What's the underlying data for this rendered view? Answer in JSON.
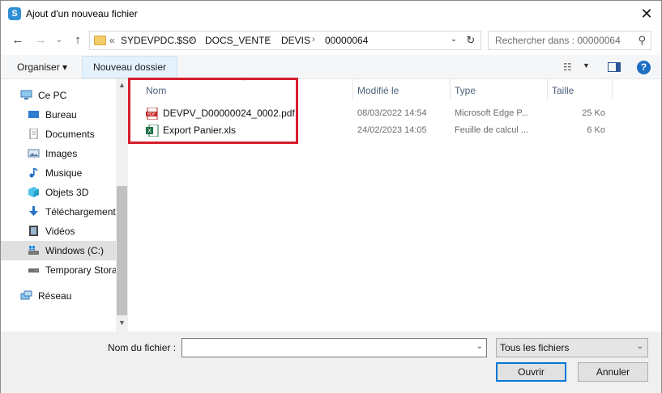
{
  "window": {
    "title": "Ajout d'un nouveau fichier"
  },
  "address": {
    "prefix": "«",
    "crumbs": [
      "SYDEVPDC.$SO",
      "DOCS_VENTE",
      "DEVIS",
      "00000064"
    ],
    "separator": "›"
  },
  "search": {
    "placeholder": "Rechercher dans : 00000064"
  },
  "toolbar": {
    "organise_label": "Organiser ▾",
    "new_folder_label": "Nouveau dossier"
  },
  "sidebar": {
    "items": [
      {
        "label": "Ce PC",
        "icon": "pc-icon"
      },
      {
        "label": "Bureau",
        "icon": "desktop-icon"
      },
      {
        "label": "Documents",
        "icon": "documents-icon"
      },
      {
        "label": "Images",
        "icon": "pictures-icon"
      },
      {
        "label": "Musique",
        "icon": "music-icon"
      },
      {
        "label": "Objets 3D",
        "icon": "objects3d-icon"
      },
      {
        "label": "Téléchargements",
        "icon": "downloads-icon"
      },
      {
        "label": "Vidéos",
        "icon": "videos-icon"
      },
      {
        "label": "Windows (C:)",
        "icon": "drive-c-icon"
      },
      {
        "label": "Temporary Storage",
        "icon": "drive-icon"
      },
      {
        "label": "Réseau",
        "icon": "network-icon"
      }
    ]
  },
  "columns": {
    "name": "Nom",
    "modified": "Modifié le",
    "type": "Type",
    "size": "Taille"
  },
  "files": [
    {
      "name": "DEVPV_D00000024_0002.pdf",
      "modified": "08/03/2022 14:54",
      "type": "Microsoft Edge P...",
      "size": "25 Ko",
      "icon": "pdf-icon"
    },
    {
      "name": "Export Panier.xls",
      "modified": "24/02/2023 14:05",
      "type": "Feuille de calcul ...",
      "size": "6 Ko",
      "icon": "excel-icon"
    }
  ],
  "footer": {
    "filename_label": "Nom du fichier :",
    "filename_value": "",
    "filter_label": "Tous les fichiers",
    "open_label": "Ouvrir",
    "cancel_label": "Annuler"
  },
  "colors": {
    "accent": "#0078d7",
    "highlight_border": "#d61f2c",
    "selection": "#e0e0e0"
  }
}
